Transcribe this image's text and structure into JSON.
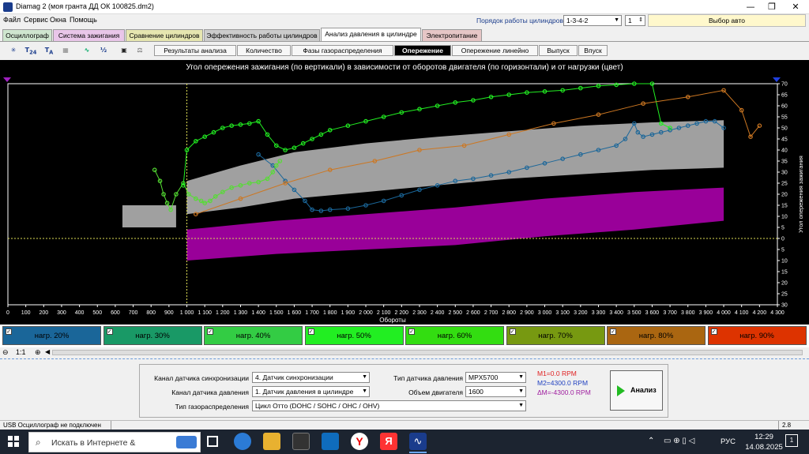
{
  "window": {
    "title": "Diamag 2 (моя гранта ДД ОК 100825.dm2)",
    "minimize": "—",
    "maximize": "❐",
    "close": "✕"
  },
  "menu": [
    "Файл",
    "Сервис",
    "Окна",
    "Помощь"
  ],
  "cylinder_order": {
    "label": "Порядок работы цилиндров",
    "value": "1-3-4-2",
    "spinner_value": "1",
    "auto_select": "Выбор авто"
  },
  "tabs": [
    "Осциллограф",
    "Система зажигания",
    "Сравнение цилиндров",
    "Эффективность работы цилиндров",
    "Анализ давления в цилиндре",
    "Электропитание"
  ],
  "toolbar_icons": [
    "oscilloscope-icon",
    "t-sync-icon",
    "t-auto-icon",
    "chart-mode-icon",
    "curve-icon",
    "alg-icon",
    "save-icon",
    "scales-icon"
  ],
  "subtabs": [
    "Результаты анализа",
    "Количество",
    "Фазы газораспределения",
    "Опережение",
    "Опережение линейно",
    "Выпуск",
    "Впуск"
  ],
  "chart_data": {
    "type": "scatter",
    "title": "Угол опережения зажигания (по вертикали) в зависимости от оборотов двигателя (по горизонтали) и от нагрузки (цвет)",
    "xlabel": "Обороты",
    "ylabel": "Угол опережения зажигания",
    "xlim": [
      0,
      4300
    ],
    "ylim": [
      -30,
      70
    ],
    "x_ticks": [
      0,
      100,
      200,
      300,
      400,
      500,
      600,
      700,
      800,
      900,
      1000,
      1100,
      1200,
      1300,
      1400,
      1500,
      1600,
      1700,
      1800,
      1900,
      2000,
      2100,
      2200,
      2300,
      2400,
      2500,
      2600,
      2700,
      2800,
      2900,
      3000,
      3100,
      3200,
      3300,
      3400,
      3500,
      3600,
      3700,
      3800,
      3900,
      4000,
      4100,
      4200,
      4300
    ],
    "x_tick_labels": [
      "0",
      "100",
      "200",
      "300",
      "400",
      "500",
      "600",
      "700",
      "800",
      "900",
      "1 000",
      "1 100",
      "1 200",
      "1 300",
      "1 400",
      "1 500",
      "1 600",
      "1 700",
      "1 800",
      "1 900",
      "2 000",
      "2 100",
      "2 200",
      "2 300",
      "2 400",
      "2 500",
      "2 600",
      "2 700",
      "2 800",
      "2 900",
      "3 000",
      "3 100",
      "3 200",
      "3 300",
      "3 400",
      "3 500",
      "3 600",
      "3 700",
      "3 800",
      "3 900",
      "4 000",
      "4 100",
      "4 200",
      "4 300"
    ],
    "y_ticks": [
      70,
      65,
      60,
      55,
      50,
      45,
      40,
      35,
      30,
      25,
      20,
      15,
      10,
      5,
      0,
      -5,
      -10,
      -15,
      -20,
      -25,
      -30
    ],
    "y_tick_labels": [
      "70",
      "65",
      "60",
      "55",
      "50",
      "45",
      "40",
      "35",
      "30",
      "25",
      "20",
      "15",
      "10",
      "5",
      "0",
      "5",
      "10",
      "15",
      "20",
      "25",
      "30"
    ],
    "reference_bands": [
      {
        "color": "#a0a0a0",
        "x": [
          640,
          940
        ],
        "lower": [
          5,
          5
        ],
        "upper": [
          15,
          15
        ]
      },
      {
        "color": "#a0a0a0",
        "x": [
          1000,
          1300,
          1600,
          2000,
          2400,
          2800,
          3200,
          3600,
          4000
        ],
        "lower": [
          11,
          14,
          18,
          21,
          24,
          27,
          29,
          31,
          32
        ],
        "upper": [
          26,
          33,
          39,
          43,
          46,
          48.5,
          51,
          52.5,
          53.5
        ]
      },
      {
        "color": "#990099",
        "x": [
          1000,
          1500,
          2000,
          2500,
          3000,
          3500,
          4000
        ],
        "lower": [
          -10,
          -7,
          -5,
          -3,
          1,
          4,
          8
        ],
        "upper": [
          4,
          8,
          11,
          14,
          18,
          21,
          23
        ]
      }
    ],
    "series": [
      {
        "name": "нагр. 20%",
        "color": "#1a6699",
        "points": [
          [
            1400,
            38
          ],
          [
            1480,
            33
          ],
          [
            1550,
            26
          ],
          [
            1600,
            22
          ],
          [
            1660,
            17
          ],
          [
            1700,
            13
          ],
          [
            1750,
            12.5
          ],
          [
            1800,
            13
          ],
          [
            1900,
            13.5
          ],
          [
            2000,
            15
          ],
          [
            2100,
            17
          ],
          [
            2200,
            19.5
          ],
          [
            2300,
            22
          ],
          [
            2400,
            24
          ],
          [
            2500,
            26
          ],
          [
            2600,
            27
          ],
          [
            2700,
            28.5
          ],
          [
            2800,
            30
          ],
          [
            2900,
            32
          ],
          [
            3000,
            34
          ],
          [
            3100,
            36
          ],
          [
            3200,
            38
          ],
          [
            3300,
            40
          ],
          [
            3400,
            42
          ],
          [
            3450,
            45
          ],
          [
            3500,
            52
          ],
          [
            3520,
            48
          ],
          [
            3550,
            46
          ],
          [
            3600,
            47
          ],
          [
            3650,
            48
          ],
          [
            3700,
            49
          ],
          [
            3750,
            50
          ],
          [
            3800,
            51
          ],
          [
            3850,
            52
          ],
          [
            3900,
            53
          ],
          [
            3950,
            53
          ],
          [
            4000,
            50
          ]
        ]
      },
      {
        "name": "нагр. 30%",
        "color": "#199966",
        "points": []
      },
      {
        "name": "нагр. 40%",
        "color": "#55dd33",
        "points": [
          [
            820,
            31
          ],
          [
            850,
            26
          ],
          [
            870,
            20
          ],
          [
            890,
            16
          ],
          [
            910,
            13
          ],
          [
            940,
            20
          ],
          [
            980,
            25
          ],
          [
            1010,
            20
          ],
          [
            1050,
            18
          ],
          [
            1080,
            17
          ],
          [
            1100,
            16
          ],
          [
            1130,
            17
          ],
          [
            1160,
            19
          ],
          [
            1200,
            21
          ],
          [
            1250,
            23
          ],
          [
            1300,
            24
          ],
          [
            1350,
            25
          ],
          [
            1400,
            25.5
          ],
          [
            1450,
            27
          ],
          [
            1480,
            30
          ],
          [
            1500,
            33
          ],
          [
            1520,
            35
          ]
        ]
      },
      {
        "name": "нагр. 50%",
        "color": "#22ee22",
        "points": [
          [
            980,
            24
          ],
          [
            1000,
            40
          ],
          [
            1050,
            44
          ],
          [
            1100,
            46
          ],
          [
            1150,
            48
          ],
          [
            1200,
            50
          ],
          [
            1250,
            51
          ],
          [
            1300,
            51.5
          ],
          [
            1350,
            52
          ],
          [
            1400,
            53
          ],
          [
            1450,
            47
          ],
          [
            1500,
            42
          ],
          [
            1550,
            40
          ],
          [
            1600,
            41
          ],
          [
            1650,
            43
          ],
          [
            1700,
            45
          ],
          [
            1750,
            47
          ],
          [
            1800,
            49
          ],
          [
            1900,
            51
          ],
          [
            2000,
            53
          ],
          [
            2100,
            55
          ],
          [
            2200,
            57
          ],
          [
            2300,
            58.5
          ],
          [
            2400,
            60
          ],
          [
            2500,
            61.5
          ],
          [
            2600,
            62.5
          ],
          [
            2700,
            64
          ],
          [
            2800,
            65
          ],
          [
            2900,
            66
          ],
          [
            3000,
            66.5
          ],
          [
            3100,
            67
          ],
          [
            3200,
            68
          ],
          [
            3300,
            69
          ],
          [
            3400,
            69.5
          ],
          [
            3500,
            70
          ],
          [
            3600,
            70
          ],
          [
            3650,
            52
          ],
          [
            3700,
            50
          ]
        ]
      },
      {
        "name": "нагр. 60%",
        "color": "#33dd11",
        "points": []
      },
      {
        "name": "нагр. 70%",
        "color": "#779911",
        "points": []
      },
      {
        "name": "нагр. 80%",
        "color": "#cc7722",
        "points": [
          [
            1050,
            11
          ],
          [
            1300,
            18
          ],
          [
            1550,
            25
          ],
          [
            1800,
            31
          ],
          [
            2050,
            35
          ],
          [
            2300,
            40
          ],
          [
            2550,
            42
          ],
          [
            2800,
            47
          ],
          [
            3050,
            52
          ],
          [
            3300,
            56
          ],
          [
            3550,
            61
          ],
          [
            3800,
            64
          ],
          [
            4000,
            67
          ],
          [
            4100,
            58
          ],
          [
            4150,
            46
          ],
          [
            4200,
            51
          ]
        ]
      },
      {
        "name": "нагр. 90%",
        "color": "#dd3300",
        "points": []
      }
    ]
  },
  "legend": [
    {
      "label": "нагр. 20%",
      "color": "#1a6699",
      "text": "#000"
    },
    {
      "label": "нагр. 30%",
      "color": "#199966",
      "text": "#000"
    },
    {
      "label": "нагр. 40%",
      "color": "#33cc44",
      "text": "#000"
    },
    {
      "label": "нагр. 50%",
      "color": "#22ee22",
      "text": "#000"
    },
    {
      "label": "нагр. 60%",
      "color": "#33dd11",
      "text": "#000"
    },
    {
      "label": "нагр. 70%",
      "color": "#779911",
      "text": "#000"
    },
    {
      "label": "нагр. 80%",
      "color": "#aa6611",
      "text": "#000"
    },
    {
      "label": "нагр. 90%",
      "color": "#dd3300",
      "text": "#000"
    }
  ],
  "zoom": {
    "label": "1:1"
  },
  "settings": {
    "sync_channel_label": "Канал датчика синхронизации",
    "sync_channel_value": "4.  Датчик синхронизации",
    "pressure_channel_label": "Канал датчика давления",
    "pressure_channel_value": "1.  Датчик давления в цилиндре",
    "timing_type_label": "Тип газораспределения",
    "timing_type_value": "Цикл Отто (DOHC / SOHC / OHC / OHV)",
    "sensor_type_label": "Тип датчика давления",
    "sensor_type_value": "MPX5700",
    "engine_volume_label": "Объем двигателя",
    "engine_volume_value": "1600",
    "m1": "M1=0.0 RPM",
    "m2": "M2=4300.0 RPM",
    "dm": "ΔM=-4300.0 RPM",
    "analyze_label": "Анализ"
  },
  "status": {
    "left": "USB Осциллограф не подключен",
    "right": "2.8"
  },
  "taskbar": {
    "search": "Искать в Интернете &",
    "lang": "РУС",
    "time": "12:29",
    "date": "14.08.2025",
    "notifications": "1"
  }
}
